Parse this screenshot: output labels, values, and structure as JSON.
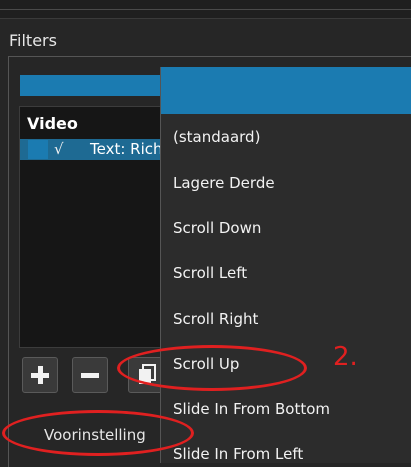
{
  "panel": {
    "title": "Filters"
  },
  "filter_list": {
    "header": "Video",
    "items": [
      {
        "check": "√",
        "label": "Text: Rich"
      }
    ]
  },
  "toolbar": {
    "add_icon": "plus-icon",
    "remove_icon": "minus-icon",
    "copy_icon": "copy-icon"
  },
  "preset": {
    "label": "Voorinstelling"
  },
  "dropdown": {
    "items": [
      {
        "label": ""
      },
      {
        "label": "(standaard)"
      },
      {
        "label": "Lagere Derde"
      },
      {
        "label": "Scroll Down"
      },
      {
        "label": "Scroll Left"
      },
      {
        "label": "Scroll Right"
      },
      {
        "label": "Scroll Up"
      },
      {
        "label": "Slide In From Bottom"
      },
      {
        "label": "Slide In From Left"
      }
    ]
  },
  "annotation": {
    "number": "2."
  },
  "colors": {
    "accent": "#1b7bb1",
    "annotation": "#e02020",
    "background": "#262626"
  }
}
